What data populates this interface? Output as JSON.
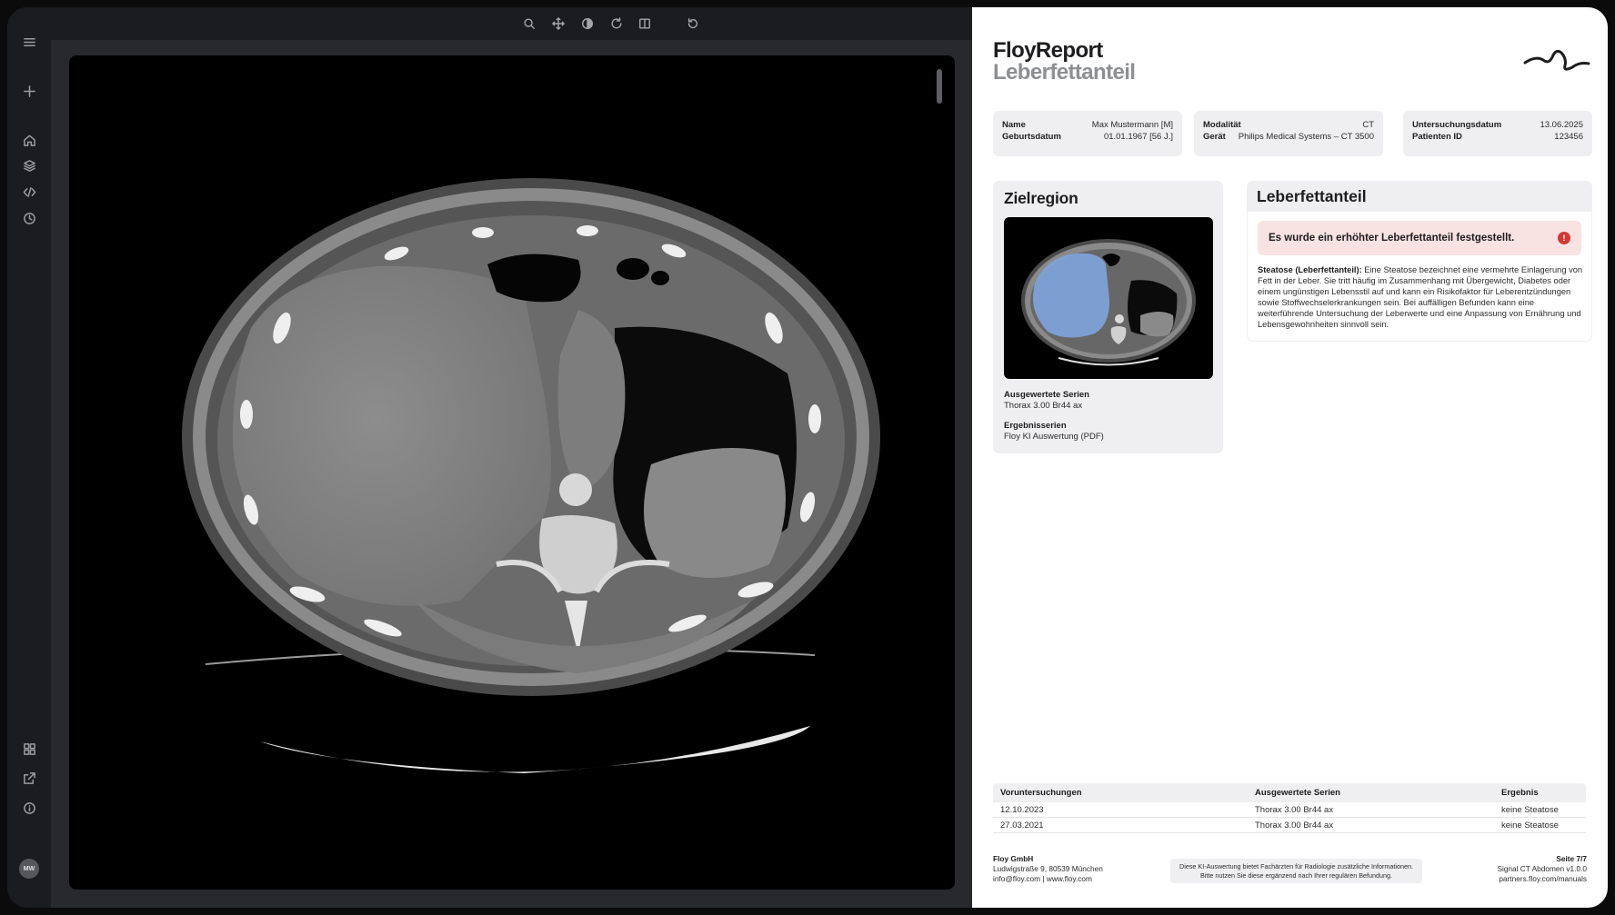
{
  "sidebar": {
    "top_icons": [
      "menu-icon",
      "plus-icon",
      "home-icon",
      "layers-icon",
      "code-icon",
      "history-icon"
    ],
    "bottom_icons": [
      "grid-icon",
      "external-link-icon",
      "info-icon"
    ],
    "avatar_initials": "MW"
  },
  "toolbar": {
    "tools": [
      "search-icon",
      "pan-icon",
      "contrast-icon",
      "rotate-icon",
      "split-view-icon",
      "undo-icon"
    ]
  },
  "report": {
    "title": "FloyReport",
    "subtitle": "Leberfettanteil",
    "patient": {
      "name_label": "Name",
      "name_value": "Max Mustermann [M]",
      "dob_label": "Geburtsdatum",
      "dob_value": "01.01.1967 [56 J.]"
    },
    "device": {
      "modality_label": "Modalität",
      "modality_value": "CT",
      "device_label": "Gerät",
      "device_value": "Philips Medical Systems – CT 3500"
    },
    "study": {
      "date_label": "Untersuchungsdatum",
      "date_value": "13.06.2025",
      "patient_id_label": "Patienten ID",
      "patient_id_value": "123456"
    },
    "target_region": {
      "heading": "Zielregion",
      "series_label": "Ausgewertete Serien",
      "series_value": "Thorax 3.00 Br44 ax",
      "result_series_label": "Ergebnisserien",
      "result_series_value": "Floy KI Auswertung (PDF)",
      "overlay_color": "#7fa3d9"
    },
    "finding": {
      "heading": "Leberfettanteil",
      "alert": "Es wurde ein erhöhter Leberfettanteil festgestellt.",
      "alert_icon": "!",
      "alert_color": "#cf3a34",
      "description_term": "Steatose (Leberfettanteil):",
      "description": " Eine Steatose bezeichnet eine vermehrte Einlagerung von Fett in der Leber. Sie tritt häufig im Zusammenhang mit Übergewicht, Diabetes oder einem ungünstigen Lebensstil auf und kann ein Risikofaktor für Leberentzündungen sowie Stoffwechselerkrankungen sein. Bei auffälligen Befunden kann eine weiterführende Untersuchung der Leberwerte und eine Anpassung von Ernährung und Lebensgewohnheiten sinnvoll sein."
    },
    "prior_studies": {
      "columns": [
        "Voruntersuchungen",
        "Ausgewertete Serien",
        "Ergebnis"
      ],
      "rows": [
        [
          "12.10.2023",
          "Thorax 3.00 Br44 ax",
          "keine Steatose"
        ],
        [
          "27.03.2021",
          "Thorax 3.00 Br44 ax",
          "keine Steatose"
        ]
      ]
    },
    "footer": {
      "company": "Floy GmbH",
      "address": "Ludwigstraße 9, 80539 München",
      "contact": "info@floy.com | www.floy.com",
      "disclaimer_1": "Diese KI-Auswertung bietet Fachärzten für Radiologie zusätzliche Informationen.",
      "disclaimer_2": "Bitte nutzen Sie diese ergänzend nach Ihrer regulären Befundung.",
      "page": "Seite 7/7",
      "product": "Signal CT Abdomen v1.0.0",
      "manuals": "partners.floy.com/manuals"
    }
  }
}
